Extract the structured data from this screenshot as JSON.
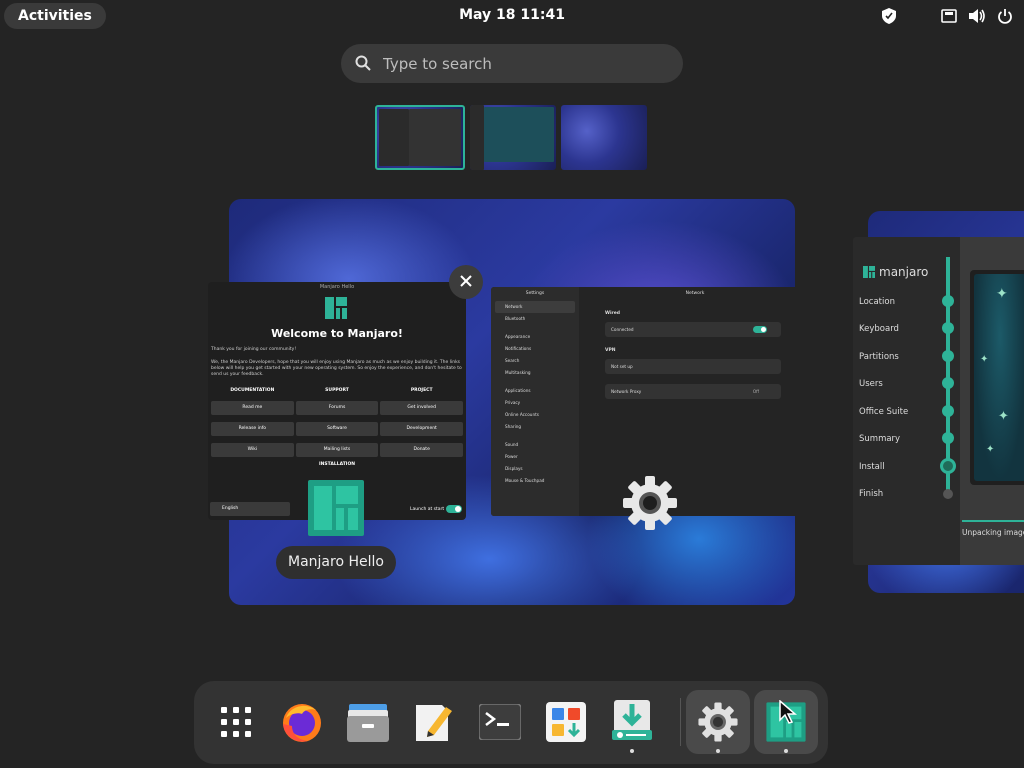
{
  "topbar": {
    "activities_label": "Activities",
    "clock": "May 18  11:41",
    "tray_icons": [
      "shield-icon",
      "network-wired-icon",
      "volume-icon",
      "power-icon"
    ]
  },
  "search": {
    "placeholder": "Type to search"
  },
  "workspaces": [
    {
      "name": "workspace-1",
      "active": true
    },
    {
      "name": "workspace-2",
      "active": false
    },
    {
      "name": "workspace-3",
      "active": false
    }
  ],
  "hello": {
    "title": "Manjaro Hello",
    "heading": "Welcome to Manjaro!",
    "para1": "Thank you for joining our community!",
    "para2": "We, the Manjaro Developers, hope that you will enjoy using Manjaro as much as we enjoy building it. The links below will help you get started with your new operating system. So enjoy the experience, and don't hesitate to send us your feedback.",
    "columns": [
      {
        "header": "DOCUMENTATION",
        "buttons": [
          "Read me",
          "Release info",
          "Wiki"
        ]
      },
      {
        "header": "SUPPORT",
        "buttons": [
          "Forums",
          "Software",
          "Mailing lists"
        ]
      },
      {
        "header": "PROJECT",
        "buttons": [
          "Get involved",
          "Development",
          "Donate"
        ]
      }
    ],
    "installation_label": "INSTALLATION",
    "language": "English",
    "launch_label": "Launch at start",
    "launch_enabled": true,
    "window_label": "Manjaro Hello"
  },
  "settings": {
    "sidebar_title": "Settings",
    "main_title": "Network",
    "sidebar_items": [
      "Network",
      "Bluetooth",
      "Appearance",
      "Notifications",
      "Search",
      "Multitasking",
      "Applications",
      "Privacy",
      "Online Accounts",
      "Sharing",
      "Sound",
      "Power",
      "Displays",
      "Mouse & Touchpad"
    ],
    "wired_label": "Wired",
    "wired_status": "Connected",
    "vpn_label": "VPN",
    "vpn_status": "Not set up",
    "proxy_label": "Network Proxy",
    "proxy_status": "Off"
  },
  "installer": {
    "brand": "manjaro",
    "steps": [
      "Location",
      "Keyboard",
      "Partitions",
      "Users",
      "Office Suite",
      "Summary",
      "Install",
      "Finish"
    ],
    "current_step": "Install",
    "progress_label": "Unpacking image"
  },
  "dock": {
    "apps": [
      {
        "name": "show-apps",
        "icon": "grid-icon",
        "running": false
      },
      {
        "name": "firefox",
        "icon": "firefox-icon",
        "running": false
      },
      {
        "name": "files",
        "icon": "files-icon",
        "running": false
      },
      {
        "name": "text-editor",
        "icon": "text-editor-icon",
        "running": false
      },
      {
        "name": "terminal",
        "icon": "terminal-icon",
        "running": false
      },
      {
        "name": "software",
        "icon": "software-icon",
        "running": false
      },
      {
        "name": "installer",
        "icon": "install-icon",
        "running": true
      },
      {
        "name": "settings",
        "icon": "gear-icon",
        "running": true
      },
      {
        "name": "manjaro-hello",
        "icon": "manjaro-icon",
        "running": true
      }
    ]
  },
  "colors": {
    "accent": "#2eb398",
    "panel": "#242424",
    "dock": "#333333"
  }
}
